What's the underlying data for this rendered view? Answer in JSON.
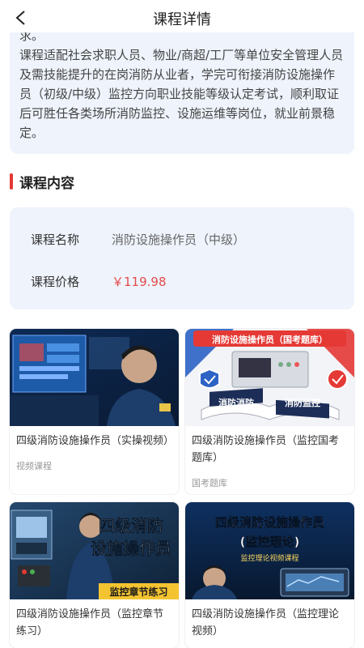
{
  "header": {
    "title": "课程详情"
  },
  "intro": {
    "cut_line": "求。",
    "text": "课程适配社会求职人员、物业/商超/工厂等单位安全管理人员及需技能提升的在岗消防从业者，学完可衔接消防设施操作员（初级/中级）监控方向职业技能等级认定考试，顺利取证后可胜任各类场所消防监控、设施运维等岗位，就业前景稳定。"
  },
  "section": {
    "title": "课程内容"
  },
  "course_info": {
    "name_label": "课程名称",
    "name_value": "消防设施操作员（中级）",
    "price_label": "课程价格",
    "price_value": "￥119.98"
  },
  "cards": [
    {
      "title": "四级消防设施操作员（实操视频）",
      "category": "视频课程",
      "image_text": ""
    },
    {
      "title": "四级消防设施操作员（监控国考题库）",
      "category": "国考题库",
      "image_banner": "消防设施操作员（国考题库）",
      "image_left": "消防消防",
      "image_right": "消防监控"
    },
    {
      "title": "四级消防设施操作员（监控章节练习）",
      "category": "",
      "image_line1": "四级消防",
      "image_line2": "设施操作员",
      "image_tag": "监控章节练习"
    },
    {
      "title": "四级消防设施操作员（监控理论视频）",
      "category": "",
      "image_line1": "四级消防设施操作员",
      "image_line2": "(监控理论)",
      "image_sub": "监控理论视频课程"
    }
  ],
  "colors": {
    "accent": "#e53935",
    "card_bg": "#eef3fc",
    "price": "#e54b4b"
  }
}
